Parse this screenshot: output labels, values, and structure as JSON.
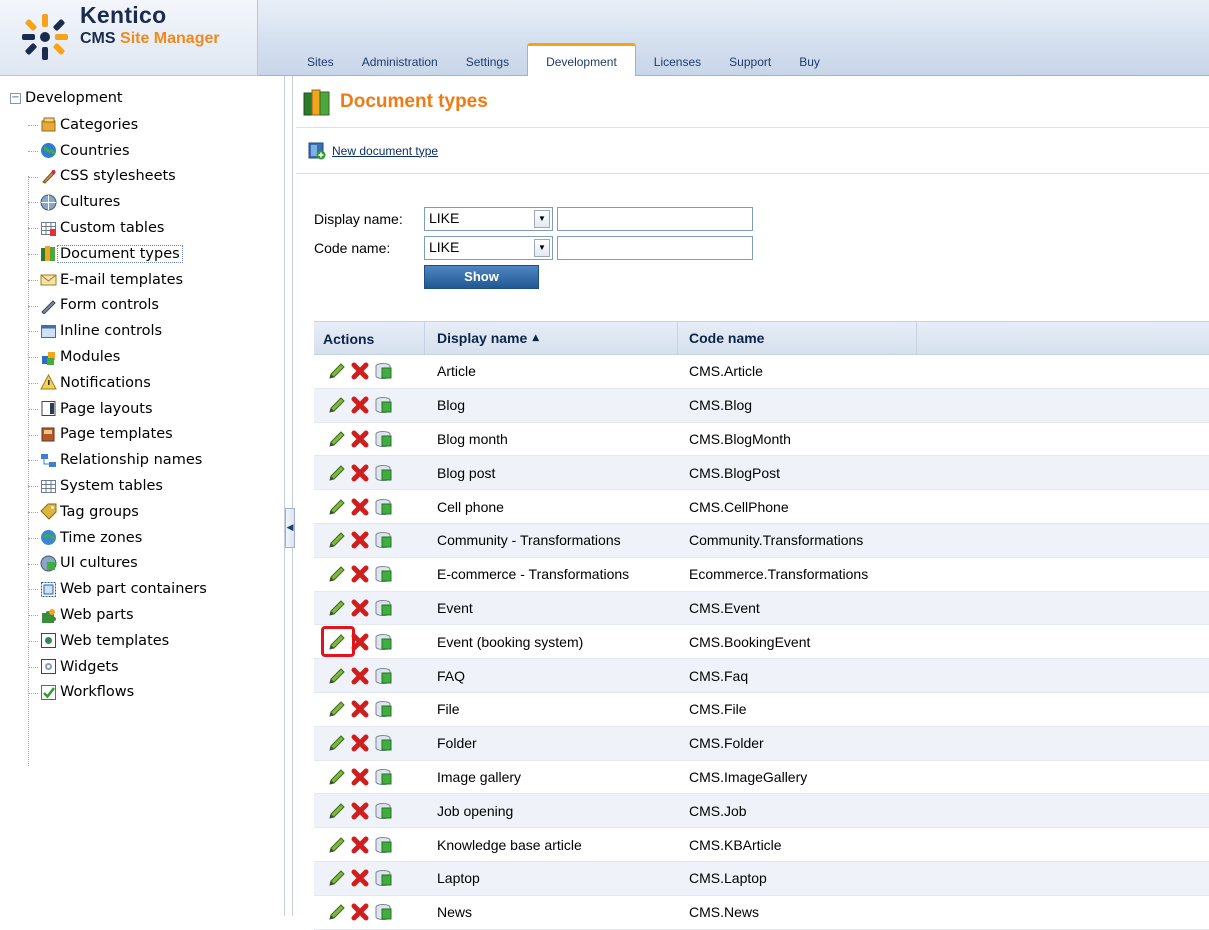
{
  "app": {
    "brand": "Kentico",
    "subtitle_prefix": "CMS",
    "subtitle_suffix": "Site Manager"
  },
  "tabs": [
    {
      "label": "Sites",
      "active": false
    },
    {
      "label": "Administration",
      "active": false
    },
    {
      "label": "Settings",
      "active": false
    },
    {
      "label": "Development",
      "active": true
    },
    {
      "label": "Licenses",
      "active": false
    },
    {
      "label": "Support",
      "active": false
    },
    {
      "label": "Buy",
      "active": false
    }
  ],
  "tree": {
    "root": "Development",
    "items": [
      {
        "label": "Categories",
        "icon": "categories-icon"
      },
      {
        "label": "Countries",
        "icon": "globe-icon"
      },
      {
        "label": "CSS stylesheets",
        "icon": "brush-icon"
      },
      {
        "label": "Cultures",
        "icon": "culture-globe-icon"
      },
      {
        "label": "Custom tables",
        "icon": "custom-table-icon"
      },
      {
        "label": "Document types",
        "icon": "books-icon",
        "selected": true
      },
      {
        "label": "E-mail templates",
        "icon": "email-icon"
      },
      {
        "label": "Form controls",
        "icon": "pen-icon"
      },
      {
        "label": "Inline controls",
        "icon": "window-icon"
      },
      {
        "label": "Modules",
        "icon": "modules-icon"
      },
      {
        "label": "Notifications",
        "icon": "warning-icon"
      },
      {
        "label": "Page layouts",
        "icon": "page-layout-icon"
      },
      {
        "label": "Page templates",
        "icon": "page-template-icon"
      },
      {
        "label": "Relationship names",
        "icon": "relationship-icon"
      },
      {
        "label": "System tables",
        "icon": "system-table-icon"
      },
      {
        "label": "Tag groups",
        "icon": "tag-icon"
      },
      {
        "label": "Time zones",
        "icon": "time-zone-icon"
      },
      {
        "label": "UI cultures",
        "icon": "ui-culture-icon"
      },
      {
        "label": "Web part containers",
        "icon": "container-icon"
      },
      {
        "label": "Web parts",
        "icon": "puzzle-icon"
      },
      {
        "label": "Web templates",
        "icon": "web-template-icon"
      },
      {
        "label": "Widgets",
        "icon": "widget-icon"
      },
      {
        "label": "Workflows",
        "icon": "workflow-check-icon"
      }
    ]
  },
  "page": {
    "title": "Document types",
    "new_link": "New document type"
  },
  "filter": {
    "display_label": "Display name:",
    "code_label": "Code name:",
    "display_operator": "LIKE",
    "code_operator": "LIKE",
    "display_value": "",
    "code_value": "",
    "show_label": "Show"
  },
  "grid": {
    "columns": {
      "actions": "Actions",
      "display": "Display name",
      "code": "Code name"
    },
    "sort": "ascending",
    "highlighted_row": 8,
    "rows": [
      {
        "display": "Article",
        "code": "CMS.Article"
      },
      {
        "display": "Blog",
        "code": "CMS.Blog"
      },
      {
        "display": "Blog month",
        "code": "CMS.BlogMonth"
      },
      {
        "display": "Blog post",
        "code": "CMS.BlogPost"
      },
      {
        "display": "Cell phone",
        "code": "CMS.CellPhone"
      },
      {
        "display": "Community - Transformations",
        "code": "Community.Transformations"
      },
      {
        "display": "E-commerce - Transformations",
        "code": "Ecommerce.Transformations"
      },
      {
        "display": "Event",
        "code": "CMS.Event"
      },
      {
        "display": "Event (booking system)",
        "code": "CMS.BookingEvent"
      },
      {
        "display": "FAQ",
        "code": "CMS.Faq"
      },
      {
        "display": "File",
        "code": "CMS.File"
      },
      {
        "display": "Folder",
        "code": "CMS.Folder"
      },
      {
        "display": "Image gallery",
        "code": "CMS.ImageGallery"
      },
      {
        "display": "Job opening",
        "code": "CMS.Job"
      },
      {
        "display": "Knowledge base article",
        "code": "CMS.KBArticle"
      },
      {
        "display": "Laptop",
        "code": "CMS.Laptop"
      },
      {
        "display": "News",
        "code": "CMS.News"
      }
    ]
  },
  "colors": {
    "accent_orange": "#f07b15",
    "active_tab_border": "#f7a21b",
    "highlight_red": "#e3131b",
    "button_blue": "#215893"
  }
}
